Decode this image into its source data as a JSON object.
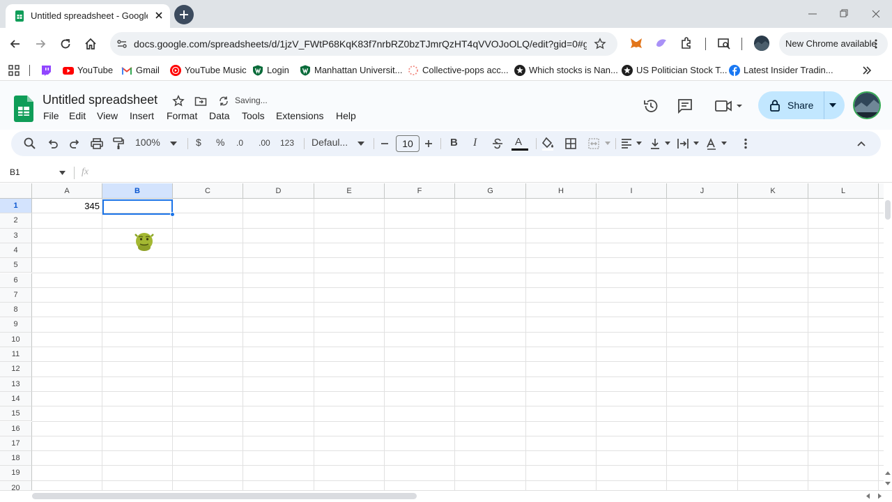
{
  "browser": {
    "tab_title": "Untitled spreadsheet - Google Sheets",
    "url": "docs.google.com/spreadsheets/d/1jzV_FWtP68KqK83f7nrbRZ0bzTJmrQzHT4qVVOJoOLQ/edit?gid=0#g...",
    "update_label": "New Chrome available"
  },
  "bookmarks": [
    {
      "label": "YouTube",
      "icon": "youtube-icon"
    },
    {
      "label": "Gmail",
      "icon": "gmail-icon"
    },
    {
      "label": "YouTube Music",
      "icon": "youtube-music-icon"
    },
    {
      "label": "Login",
      "icon": "shield-icon"
    },
    {
      "label": "Manhattan Universit...",
      "icon": "shield-icon"
    },
    {
      "label": "Collective-pops acc...",
      "icon": "loading-icon"
    },
    {
      "label": "Which stocks is Nan...",
      "icon": "star-badge-icon"
    },
    {
      "label": "US Politician Stock T...",
      "icon": "star-badge-icon"
    },
    {
      "label": "Latest Insider Tradin...",
      "icon": "facebook-icon"
    }
  ],
  "sheet": {
    "title": "Untitled spreadsheet",
    "status": "Saving...",
    "share_label": "Share",
    "menus": [
      "File",
      "Edit",
      "View",
      "Insert",
      "Format",
      "Data",
      "Tools",
      "Extensions",
      "Help"
    ]
  },
  "toolbar": {
    "zoom": "100%",
    "currency": "$",
    "percent": "%",
    "dec_decrease": ".0",
    "dec_increase": ".00",
    "number_format": "123",
    "font": "Defaul...",
    "font_size": "10",
    "bold": "B",
    "italic": "I",
    "text_color": "A"
  },
  "formula_bar": {
    "cell_ref": "B1",
    "fx": "fx"
  },
  "grid": {
    "columns": [
      "A",
      "B",
      "C",
      "D",
      "E",
      "F",
      "G",
      "H",
      "I",
      "J",
      "K",
      "L"
    ],
    "rows": [
      "1",
      "2",
      "3",
      "4",
      "5",
      "6",
      "7",
      "8",
      "9",
      "10",
      "11",
      "12",
      "13",
      "14",
      "15",
      "16",
      "17",
      "18",
      "19",
      "20"
    ],
    "selected_column": "B",
    "selected_row": "1",
    "cells": {
      "A1": "345"
    }
  },
  "colors": {
    "accent": "#1a73e8",
    "share_bg": "#c2e7ff",
    "sheets_green": "#0f9d58"
  }
}
